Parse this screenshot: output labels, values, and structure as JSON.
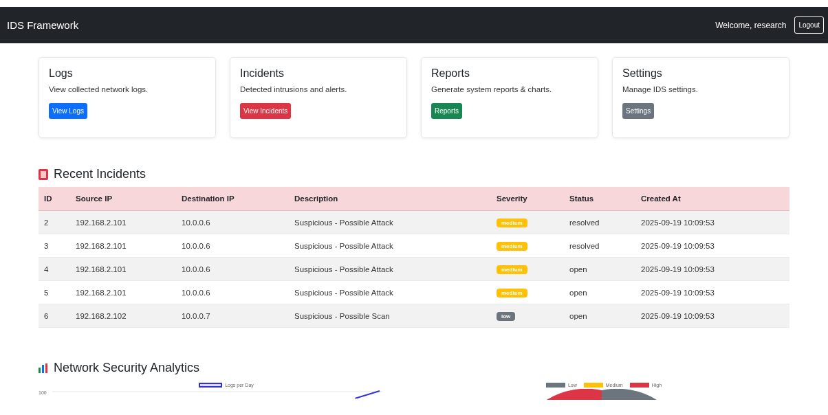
{
  "navbar": {
    "brand": "IDS Framework",
    "welcome": "Welcome, research",
    "logout": "Logout"
  },
  "cards": [
    {
      "title": "Logs",
      "text": "View collected network logs.",
      "button": "View Logs",
      "kind": "primary"
    },
    {
      "title": "Incidents",
      "text": "Detected intrusions and alerts.",
      "button": "View Incidents",
      "kind": "danger"
    },
    {
      "title": "Reports",
      "text": "Generate system reports & charts.",
      "button": "Reports",
      "kind": "success"
    },
    {
      "title": "Settings",
      "text": "Manage IDS settings.",
      "button": "Settings",
      "kind": "secondary"
    }
  ],
  "incidents": {
    "title": "Recent Incidents",
    "columns": [
      "ID",
      "Source IP",
      "Destination IP",
      "Description",
      "Severity",
      "Status",
      "Created At"
    ],
    "rows": [
      {
        "id": "2",
        "source": "192.168.2.101",
        "destination": "10.0.0.6",
        "description": "Suspicious - Possible Attack",
        "severity": "medium",
        "color": "#ffc107",
        "status": "resolved",
        "created": "2025-09-19 10:09:53"
      },
      {
        "id": "3",
        "source": "192.168.2.101",
        "destination": "10.0.0.6",
        "description": "Suspicious - Possible Attack",
        "severity": "medium",
        "color": "#ffc107",
        "status": "resolved",
        "created": "2025-09-19 10:09:53"
      },
      {
        "id": "4",
        "source": "192.168.2.101",
        "destination": "10.0.0.6",
        "description": "Suspicious - Possible Attack",
        "severity": "medium",
        "color": "#ffc107",
        "status": "open",
        "created": "2025-09-19 10:09:53"
      },
      {
        "id": "5",
        "source": "192.168.2.101",
        "destination": "10.0.0.6",
        "description": "Suspicious - Possible Attack",
        "severity": "medium",
        "color": "#ffc107",
        "status": "open",
        "created": "2025-09-19 10:09:53"
      },
      {
        "id": "6",
        "source": "192.168.2.102",
        "destination": "10.0.0.7",
        "description": "Suspicious - Possible Scan",
        "severity": "low",
        "color": "#6c757d",
        "status": "open",
        "created": "2025-09-19 10:09:53"
      }
    ]
  },
  "analytics": {
    "title": "Network Security Analytics",
    "line_chart": {
      "legend": "Logs per Day",
      "y_tick": "100"
    },
    "pie_chart": {
      "legend": [
        {
          "label": "Low",
          "color": "#6c757d"
        },
        {
          "label": "Medium",
          "color": "#ffc107"
        },
        {
          "label": "High",
          "color": "#dc3545"
        }
      ]
    }
  }
}
